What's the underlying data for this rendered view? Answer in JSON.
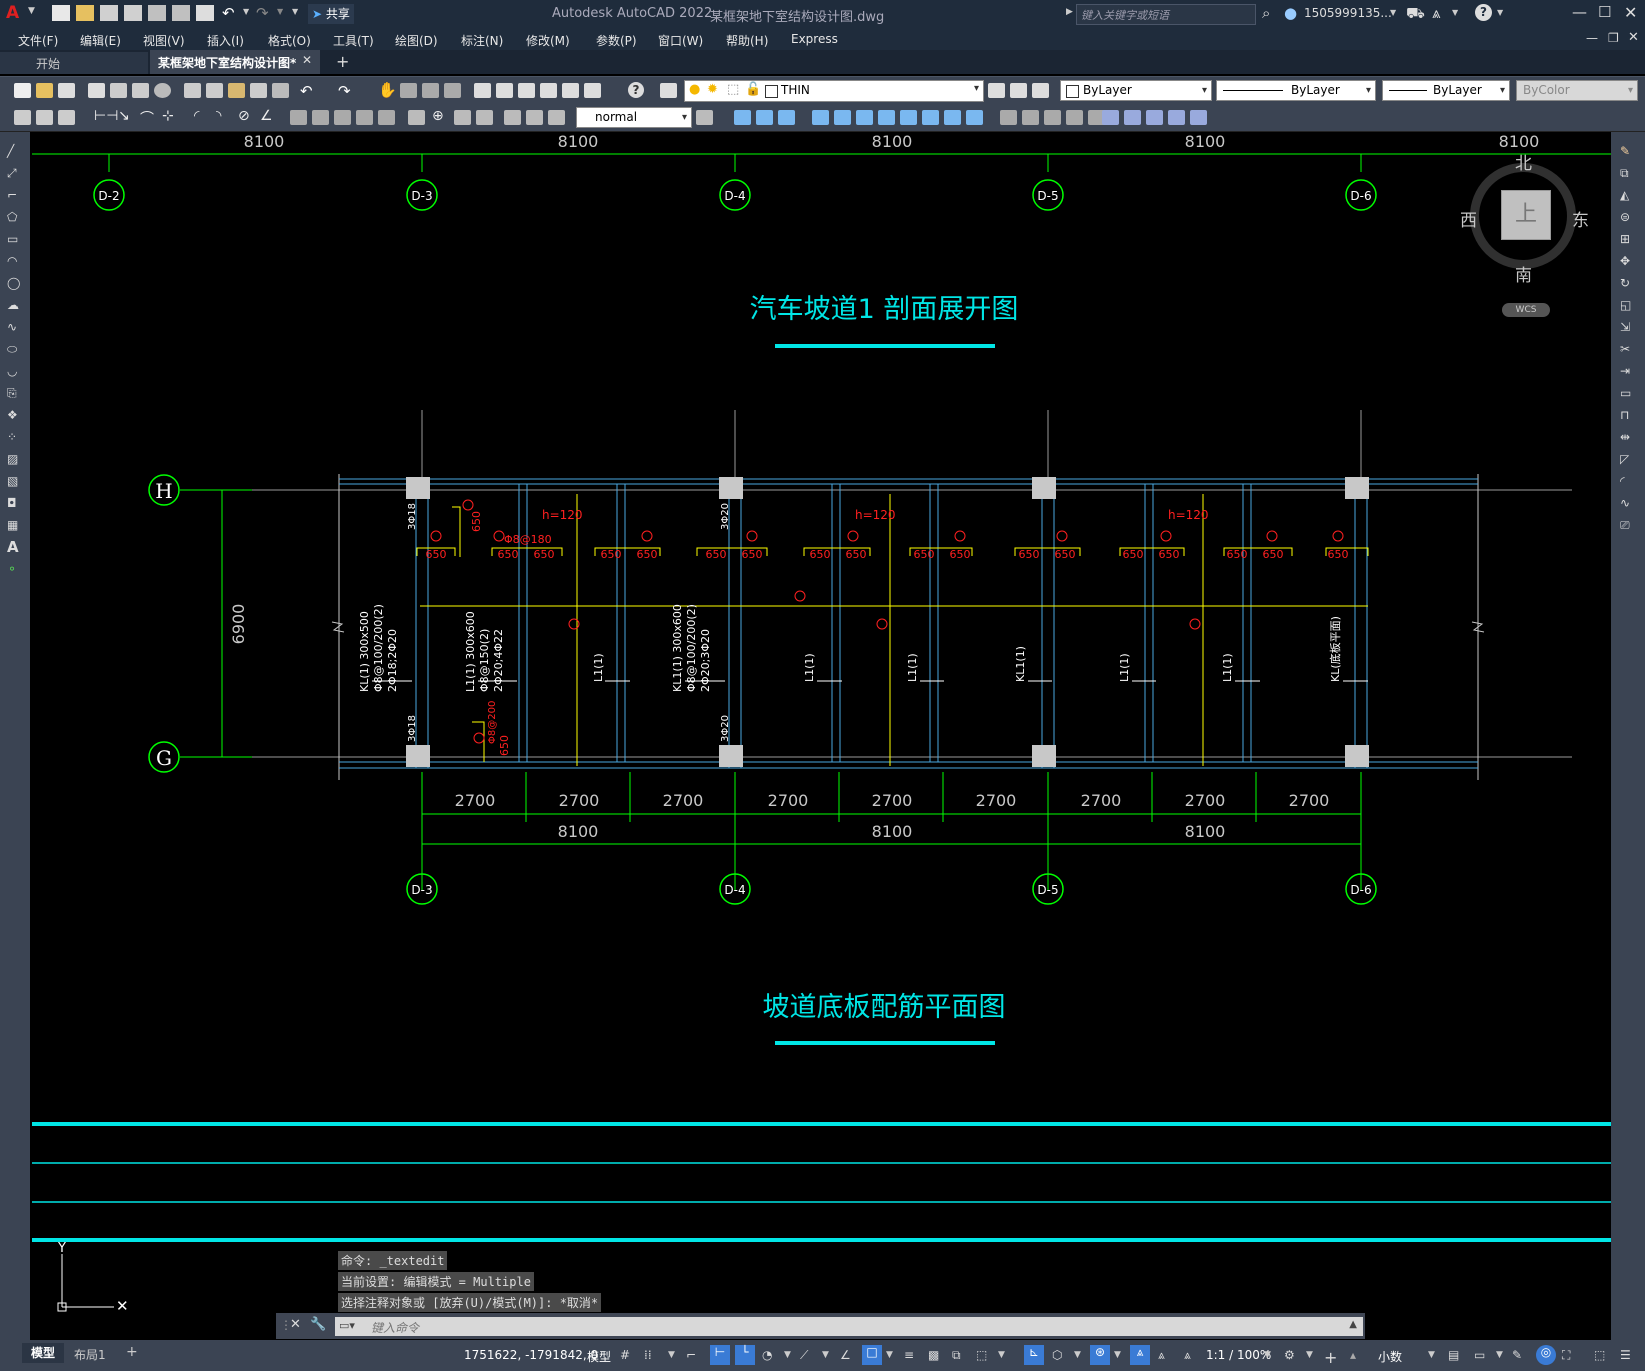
{
  "app": {
    "title": "Autodesk AutoCAD 2022",
    "filename": "某框架地下室结构设计图.dwg",
    "share": "共享",
    "search_placeholder": "键入关键字或短语",
    "user": "1505999135..."
  },
  "menu": [
    "文件(F)",
    "编辑(E)",
    "视图(V)",
    "插入(I)",
    "格式(O)",
    "工具(T)",
    "绘图(D)",
    "标注(N)",
    "修改(M)",
    "参数(P)",
    "窗口(W)",
    "帮助(H)",
    "Express"
  ],
  "tabs": {
    "start": "开始",
    "active": "某框架地下室结构设计图*"
  },
  "toolbar": {
    "layer": "THIN",
    "color": "ByLayer",
    "linetype": "ByLayer",
    "lineweight": "ByLayer",
    "plotstyle": "ByColor",
    "textstyle": "normal"
  },
  "viewcube": {
    "north": "北",
    "south": "南",
    "east": "东",
    "west": "西",
    "face": "上",
    "wcs": "WCS"
  },
  "drawing": {
    "title1": "汽车坡道1 剖面展开图",
    "title2": "坡道底板配筋平面图",
    "top_dims": [
      "8100",
      "8100",
      "8100",
      "8100",
      "8100"
    ],
    "top_axes": [
      "D-2",
      "D-3",
      "D-4",
      "D-5",
      "D-6"
    ],
    "row_axes": [
      "H",
      "G"
    ],
    "height_dim": "6900",
    "bottom_dims_small": [
      "2700",
      "2700",
      "2700",
      "2700",
      "2700",
      "2700",
      "2700",
      "2700",
      "2700"
    ],
    "bottom_dims_large": [
      "8100",
      "8100",
      "8100"
    ],
    "bottom_axes": [
      "D-3",
      "D-4",
      "D-5",
      "D-6"
    ],
    "slab_h": "h=120",
    "rebar_len": "650",
    "beam_labels": [
      "KL(1) 300x500",
      "L1(1) 300x600",
      "KL1(1) 300x600",
      "L1(1)",
      "L1(1)",
      "L1(1)",
      "KL1(1)",
      "L1(1)",
      "L1(1)",
      "KL(底板平面)"
    ],
    "beam_notes": [
      "Φ8@100/200(2)",
      "2Φ18;2Φ20",
      "Φ8@150(2)",
      "2Φ20;4Φ22",
      "Φ8@100/200(2)",
      "2Φ20;3Φ20"
    ],
    "col_marks": [
      "3Φ18",
      "3Φ20"
    ],
    "rebar_note": "Φ8@180",
    "rebar_note2": "Φ8@200"
  },
  "command": {
    "history": [
      "命令: _textedit",
      "当前设置: 编辑模式 = Multiple",
      "选择注释对象或 [放弃(U)/模式(M)]: *取消*"
    ],
    "placeholder": "键入命令"
  },
  "layout_tabs": [
    "模型",
    "布局1"
  ],
  "status": {
    "coords": "1751622, -1791842, 0",
    "model": "模型",
    "scale": "1:1 / 100%",
    "units": "小数"
  },
  "colors": {
    "cyan": "#00e6e6",
    "green": "#00ff00",
    "red": "#ff2020",
    "yellow": "#ffff00",
    "grey": "#c8c8c8"
  }
}
